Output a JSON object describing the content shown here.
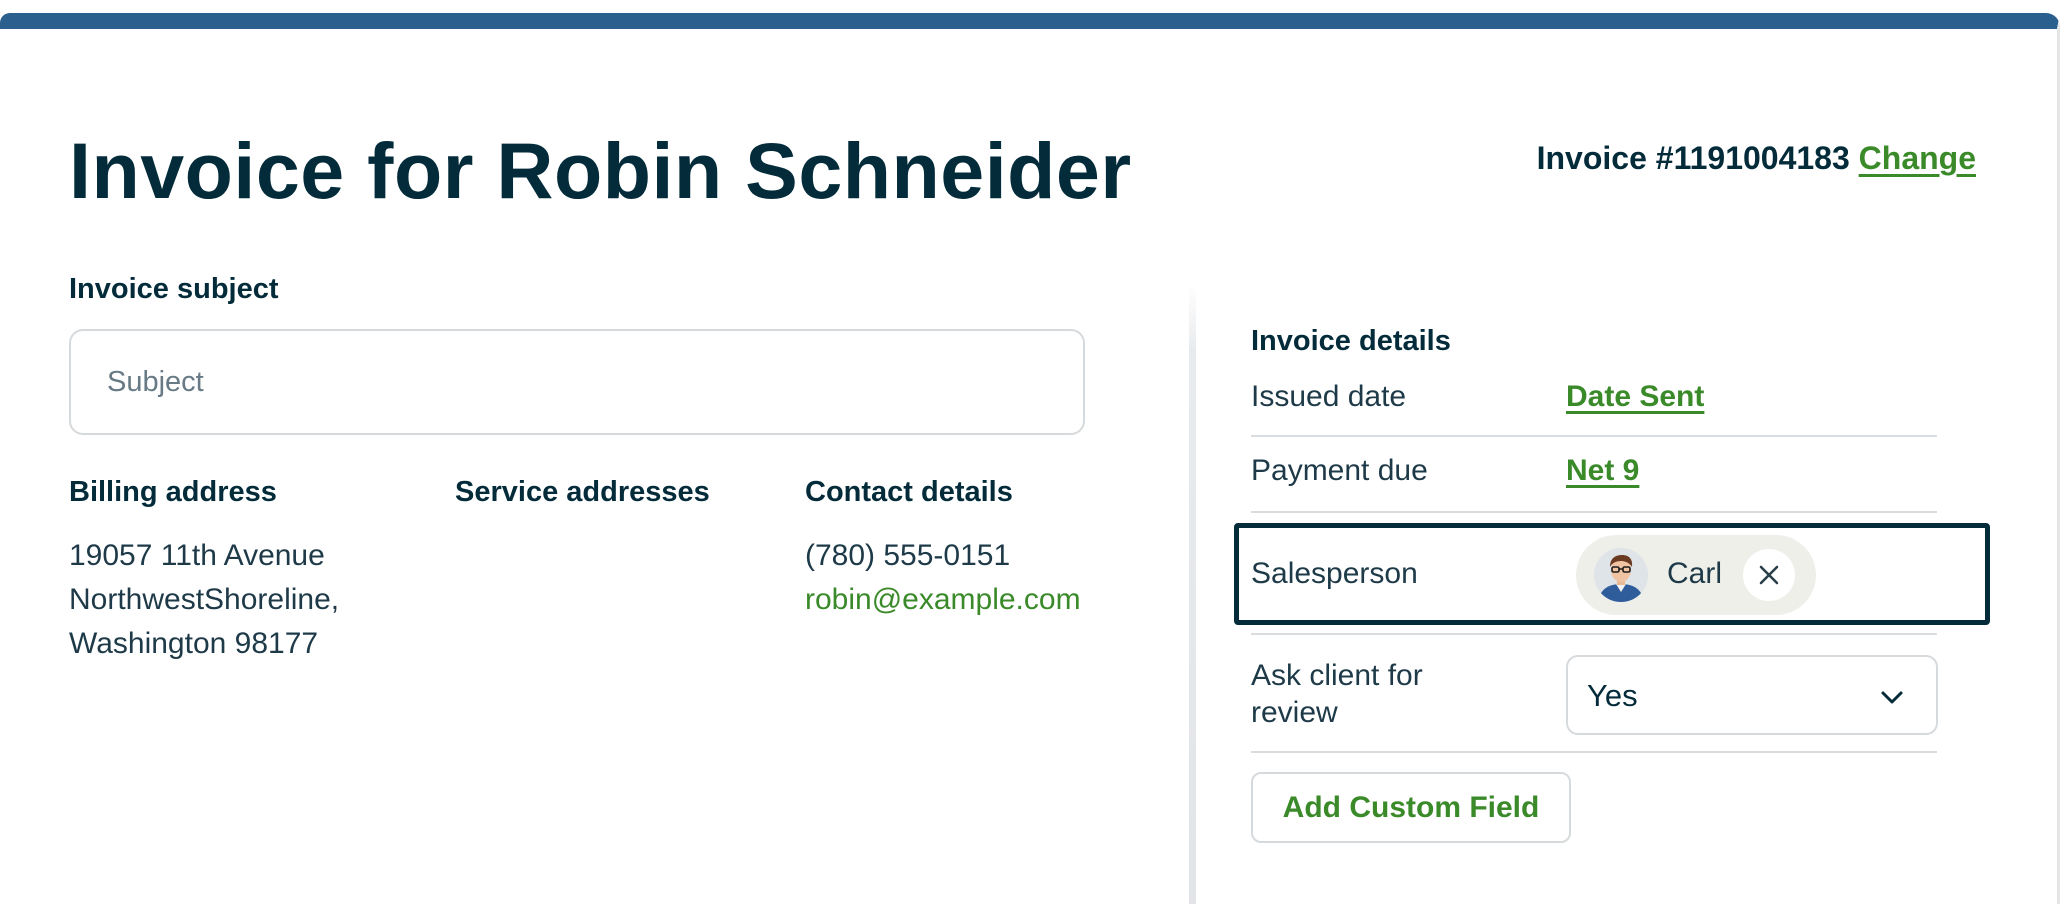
{
  "header": {
    "title": "Invoice for Robin Schneider",
    "invoice_number": "Invoice #1191004183",
    "change_label": "Change"
  },
  "subject": {
    "label": "Invoice subject",
    "placeholder": "Subject",
    "value": ""
  },
  "billing": {
    "heading": "Billing address",
    "lines": [
      "19057 11th Avenue",
      "NorthwestShoreline,",
      "Washington 98177"
    ]
  },
  "service": {
    "heading": "Service addresses"
  },
  "contact": {
    "heading": "Contact details",
    "phone": "(780) 555-0151",
    "email": "robin@example.com"
  },
  "details": {
    "heading": "Invoice details",
    "issued_label": "Issued date",
    "issued_value": "Date Sent",
    "payment_label": "Payment due",
    "payment_value": "Net 9",
    "salesperson_label": "Salesperson",
    "salesperson_name": "Carl",
    "review_label": "Ask client for review",
    "review_value": "Yes",
    "add_field_label": "Add Custom Field"
  },
  "colors": {
    "accent_green": "#3a8a2a",
    "heading_navy": "#032b3a",
    "top_bar_blue": "#2b5f8e"
  },
  "icons": {
    "remove": "close-icon",
    "dropdown": "chevron-down-icon",
    "avatar": "avatar"
  }
}
